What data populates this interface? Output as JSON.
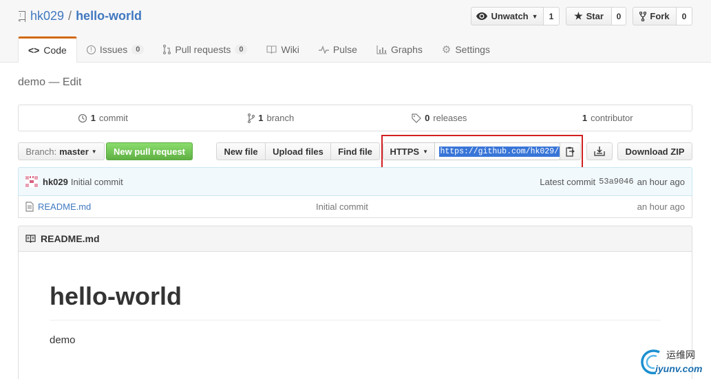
{
  "repo": {
    "owner": "hk029",
    "separator": "/",
    "name": "hello-world"
  },
  "actions": {
    "watch_label": "Unwatch",
    "watch_count": "1",
    "star_label": "Star",
    "star_count": "0",
    "fork_label": "Fork",
    "fork_count": "0"
  },
  "tabs": [
    {
      "label": "Code"
    },
    {
      "label": "Issues",
      "count": "0"
    },
    {
      "label": "Pull requests",
      "count": "0"
    },
    {
      "label": "Wiki"
    },
    {
      "label": "Pulse"
    },
    {
      "label": "Graphs"
    },
    {
      "label": "Settings"
    }
  ],
  "description": "demo — Edit",
  "summary": {
    "commits_num": "1",
    "commits_label": "commit",
    "branches_num": "1",
    "branches_label": "branch",
    "releases_num": "0",
    "releases_label": "releases",
    "contributors_num": "1",
    "contributors_label": "contributor"
  },
  "toolbar": {
    "branch_prefix": "Branch:",
    "branch_name": "master",
    "new_pr": "New pull request",
    "new_file": "New file",
    "upload_files": "Upload files",
    "find_file": "Find file",
    "protocol": "HTTPS",
    "clone_url": "https://github.com/hk029/",
    "download_zip": "Download ZIP"
  },
  "commit": {
    "author": "hk029",
    "message": "Initial commit",
    "latest_label": "Latest commit",
    "sha": "53a9046",
    "time": "an hour ago"
  },
  "files": [
    {
      "name": "README.md",
      "message": "Initial commit",
      "age": "an hour ago"
    }
  ],
  "readme": {
    "title": "README.md",
    "heading": "hello-world",
    "body": "demo"
  },
  "watermark": {
    "text_cn": "运维网",
    "domain": "iyunv.com"
  },
  "colors": {
    "link": "#4078c0",
    "accent": "#d26911",
    "green": "#6cc644",
    "highlight_box": "#d21f21",
    "selection": "#3875d7"
  }
}
